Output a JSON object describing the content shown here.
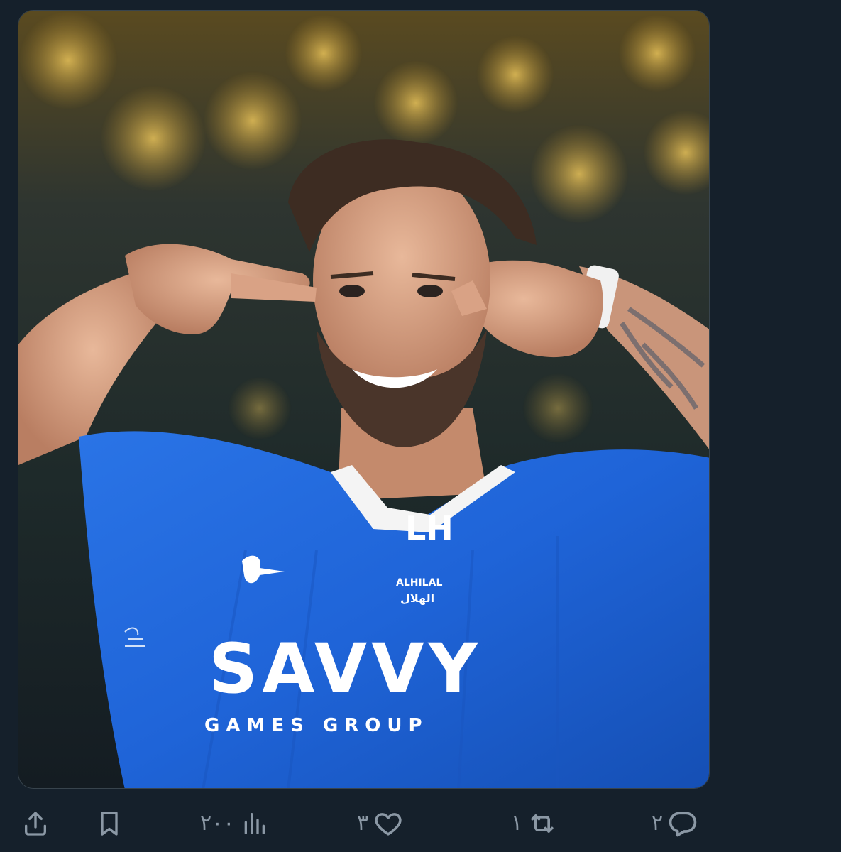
{
  "tweet": {
    "image": {
      "alt_icon": "photo-icon",
      "shirt_sponsor_main": "SAVVY",
      "shirt_sponsor_sub": "GAMES GROUP",
      "club_name_latin": "ALHILAL",
      "club_name_arabic": "الهلال",
      "club_crest_text": "LH",
      "colors": {
        "jersey": "#1f64d8",
        "background_bokeh": "#c9a24a",
        "background_dark": "#1c2a3a"
      }
    },
    "actions": {
      "share": {
        "icon": "share-icon"
      },
      "bookmark": {
        "icon": "bookmark-icon"
      },
      "views": {
        "icon": "views-chart-icon",
        "count": "٢٠٠"
      },
      "like": {
        "icon": "heart-icon",
        "count": "٣"
      },
      "retweet": {
        "icon": "retweet-icon",
        "count": "١"
      },
      "reply": {
        "icon": "reply-bubble-icon",
        "count": "٢"
      }
    }
  },
  "theme": {
    "background": "#15202b",
    "icon_color": "#8b98a5"
  }
}
